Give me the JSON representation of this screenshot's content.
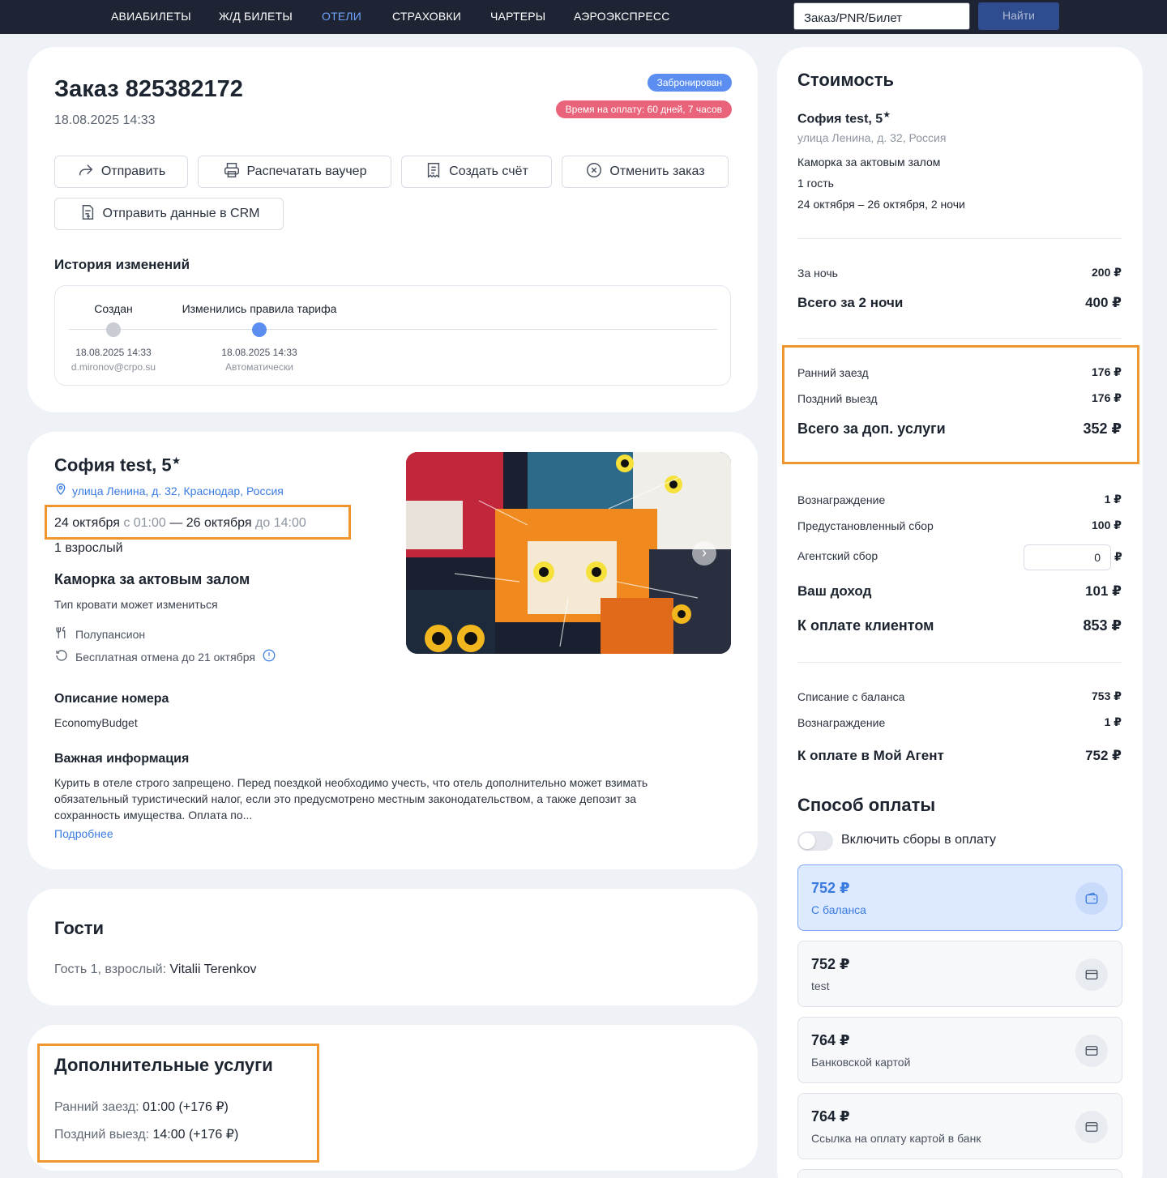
{
  "nav": {
    "items": [
      "АВИАБИЛЕТЫ",
      "Ж/Д БИЛЕТЫ",
      "ОТЕЛИ",
      "СТРАХОВКИ",
      "ЧАРТЕРЫ",
      "АЭРОЭКСПРЕСС"
    ],
    "active_index": 2,
    "search_placeholder": "Заказ/PNR/Билет",
    "search_button": "Найти"
  },
  "order": {
    "title": "Заказ 825382172",
    "date": "18.08.2025 14:33",
    "status_badge": "Забронирован",
    "payment_time_badge": "Время на оплату: 60 дней, 7 часов",
    "actions": {
      "send": "Отправить",
      "print_voucher": "Распечатать ваучер",
      "create_invoice": "Создать счёт",
      "cancel_order": "Отменить заказ",
      "send_crm": "Отправить данные в CRM"
    },
    "history": {
      "title": "История изменений",
      "events": [
        {
          "label": "Создан",
          "date": "18.08.2025 14:33",
          "by": "d.mironov@crpo.su"
        },
        {
          "label": "Изменились правила тарифа",
          "date": "18.08.2025 14:33",
          "by": "Автоматически"
        }
      ]
    }
  },
  "hotel": {
    "name": "София test, 5",
    "stars_glyph": "★",
    "address": "улица Ленина, д. 32, Краснодар, Россия",
    "checkin_date": "24 октября",
    "checkin_time": "с 01:00",
    "dash": "—",
    "checkout_date": "26 октября",
    "checkout_time": "до 14:00",
    "guests": "1 взрослый",
    "room_name": "Каморка за актовым залом",
    "room_note": "Тип кровати может измениться",
    "meal": "Полупансион",
    "cancellation": "Бесплатная отмена до 21 октября",
    "room_desc_title": "Описание номера",
    "room_desc": "EconomyBudget",
    "important_title": "Важная информация",
    "important_text": "Курить в отеле строго запрещено. Перед поездкой необходимо учесть, что отель дополнительно может взимать обязательный туристический налог, если это предусмотрено местным законодательством, а также депозит за сохранность имущества. Оплата по...",
    "more_link": "Подробнее"
  },
  "guests_section": {
    "title": "Гости",
    "guest_label": "Гость 1, взрослый:",
    "guest_name": "Vitalii Terenkov"
  },
  "extras_section": {
    "title": "Дополнительные услуги",
    "items": [
      {
        "label": "Ранний заезд:",
        "value": "01:00 (+176 ₽)"
      },
      {
        "label": "Поздний выезд:",
        "value": "14:00 (+176 ₽)"
      }
    ]
  },
  "cost": {
    "title": "Стоимость",
    "hotel_name": "София test, 5",
    "stars_glyph": "★",
    "hotel_address": "улица Ленина, д. 32, Россия",
    "room": "Каморка за актовым залом",
    "guests": "1 гость",
    "dates": "24 октября – 26 октября, 2 ночи",
    "per_night_label": "За ночь",
    "per_night_value": "200 ₽",
    "total_nights_label": "Всего за 2 ночи",
    "total_nights_value": "400 ₽",
    "early_label": "Ранний заезд",
    "early_value": "176 ₽",
    "late_label": "Поздний выезд",
    "late_value": "176 ₽",
    "extras_total_label": "Всего за доп. услуги",
    "extras_total_value": "352 ₽",
    "reward_label": "Вознаграждение",
    "reward_value": "1 ₽",
    "preset_fee_label": "Предустановленный сбор",
    "preset_fee_value": "100 ₽",
    "agent_fee_label": "Агентский сбор",
    "agent_fee_value": "0",
    "agent_fee_currency": "₽",
    "income_label": "Ваш доход",
    "income_value": "101 ₽",
    "client_pay_label": "К оплате клиентом",
    "client_pay_value": "853 ₽",
    "balance_debit_label": "Списание с баланса",
    "balance_debit_value": "753 ₽",
    "reward2_label": "Вознаграждение",
    "reward2_value": "1 ₽",
    "agent_pay_label": "К оплате в Мой Агент",
    "agent_pay_value": "752 ₽"
  },
  "payment": {
    "title": "Способ оплаты",
    "toggle_label": "Включить сборы в оплату",
    "toggle_on": false,
    "options": [
      {
        "amount": "752 ₽",
        "name": "С баланса",
        "icon": "wallet-icon",
        "selected": true
      },
      {
        "amount": "752 ₽",
        "name": "test",
        "icon": "card-icon",
        "selected": false
      },
      {
        "amount": "764 ₽",
        "name": "Банковской картой",
        "icon": "card-icon",
        "selected": false
      },
      {
        "amount": "764 ₽",
        "name": "Ссылка на оплату картой в банк",
        "icon": "card-icon",
        "selected": false
      }
    ]
  },
  "colors": {
    "nav_bg": "#1e2433",
    "accent": "#3a7be0",
    "status_badge": "#5b8ef0",
    "time_badge": "#e9637a",
    "highlight": "#f0962e",
    "page_bg": "#eef1f6"
  }
}
